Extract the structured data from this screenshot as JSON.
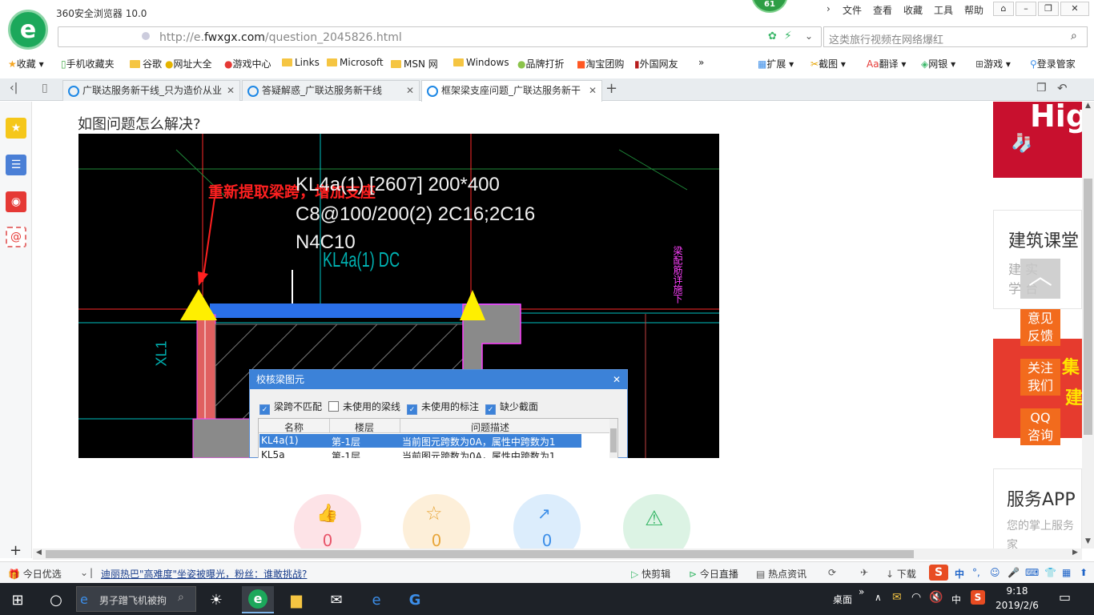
{
  "browser": {
    "title": "360安全浏览器 10.0",
    "badge": "61",
    "menus": [
      "文件",
      "查看",
      "收藏",
      "工具",
      "帮助"
    ],
    "url_prefix": "http://e.",
    "url_domain": "fwxgx.com",
    "url_path": "/question_2045826.html",
    "search_placeholder": "这类旅行视频在网络爆红"
  },
  "bookmarks": {
    "left": [
      "收藏",
      "手机收藏夹",
      "谷歌",
      "网址大全",
      "游戏中心",
      "Links",
      "Microsoft",
      "MSN 网",
      "Windows",
      "品牌打折",
      "淘宝团购",
      "外国网友",
      "»"
    ],
    "right": [
      "扩展",
      "截图",
      "翻译",
      "网银",
      "游戏",
      "登录管家"
    ]
  },
  "tabs": [
    {
      "label": "广联达服务新干线_只为造价从业"
    },
    {
      "label": "答疑解惑_广联达服务新干线"
    },
    {
      "label": "框架梁支座问题_广联达服务新干"
    }
  ],
  "page": {
    "question": "如图问题怎么解决?",
    "cad": {
      "annotation": "重新提取梁跨，增加支座",
      "beam_line1": "KL4a(1) [2607] 200*400",
      "beam_line2": "C8@100/200(2) 2C16;2C16",
      "beam_line3": "N4C10",
      "beam_tag": "KL4a(1) DC",
      "side_tag": "XL1",
      "right_note": "梁配筋详施下"
    },
    "dialog": {
      "title": "校核梁图元",
      "checks": [
        {
          "label": "梁跨不匹配",
          "checked": true
        },
        {
          "label": "未使用的梁线",
          "checked": false
        },
        {
          "label": "未使用的标注",
          "checked": true
        },
        {
          "label": "缺少截面",
          "checked": true
        }
      ],
      "columns": [
        "名称",
        "楼层",
        "问题描述"
      ],
      "rows": [
        {
          "name": "KL4a(1)",
          "floor": "第-1层",
          "desc": "当前图元跨数为0A，属性中跨数为1"
        },
        {
          "name": "KL5a",
          "floor": "第-1层",
          "desc": "当前图元跨数为0A，属性中跨数为1"
        }
      ]
    },
    "actions": [
      {
        "icon": "thumbs-up-icon",
        "count": "0",
        "color": "#e8556a",
        "bg": "#fde3e7"
      },
      {
        "icon": "star-icon",
        "count": "0",
        "color": "#e8a73c",
        "bg": "#fdefd9"
      },
      {
        "icon": "share-icon",
        "count": "0",
        "color": "#3c8ee8",
        "bg": "#dcedfc"
      },
      {
        "icon": "warning-icon",
        "count": "",
        "color": "#3cb86a",
        "bg": "#dcf3e4"
      }
    ],
    "sidebar": {
      "ad_text": "Hig",
      "course_title": "建筑课堂",
      "course_sub1": "建 实",
      "course_sub2": "学 台",
      "promo_text": "集",
      "promo_text2": "建",
      "service_title": "服务APP",
      "service_sub1": "您的掌上服务",
      "service_sub2": "家"
    },
    "float_buttons": [
      "意见\n反馈",
      "关注\n我们",
      "QQ\n咨询"
    ]
  },
  "statusbar": {
    "left": "今日优选",
    "news": "迪丽热巴\"高难度\"坐姿被曝光，粉丝：谁敢挑战?",
    "items": [
      "快剪辑",
      "今日直播",
      "热点资讯",
      "下载"
    ],
    "ime": "中"
  },
  "taskbar": {
    "search_text": "男子蹭飞机被拘",
    "desktop": "桌面",
    "ime": "中",
    "time": "9:18",
    "date": "2019/2/6"
  }
}
